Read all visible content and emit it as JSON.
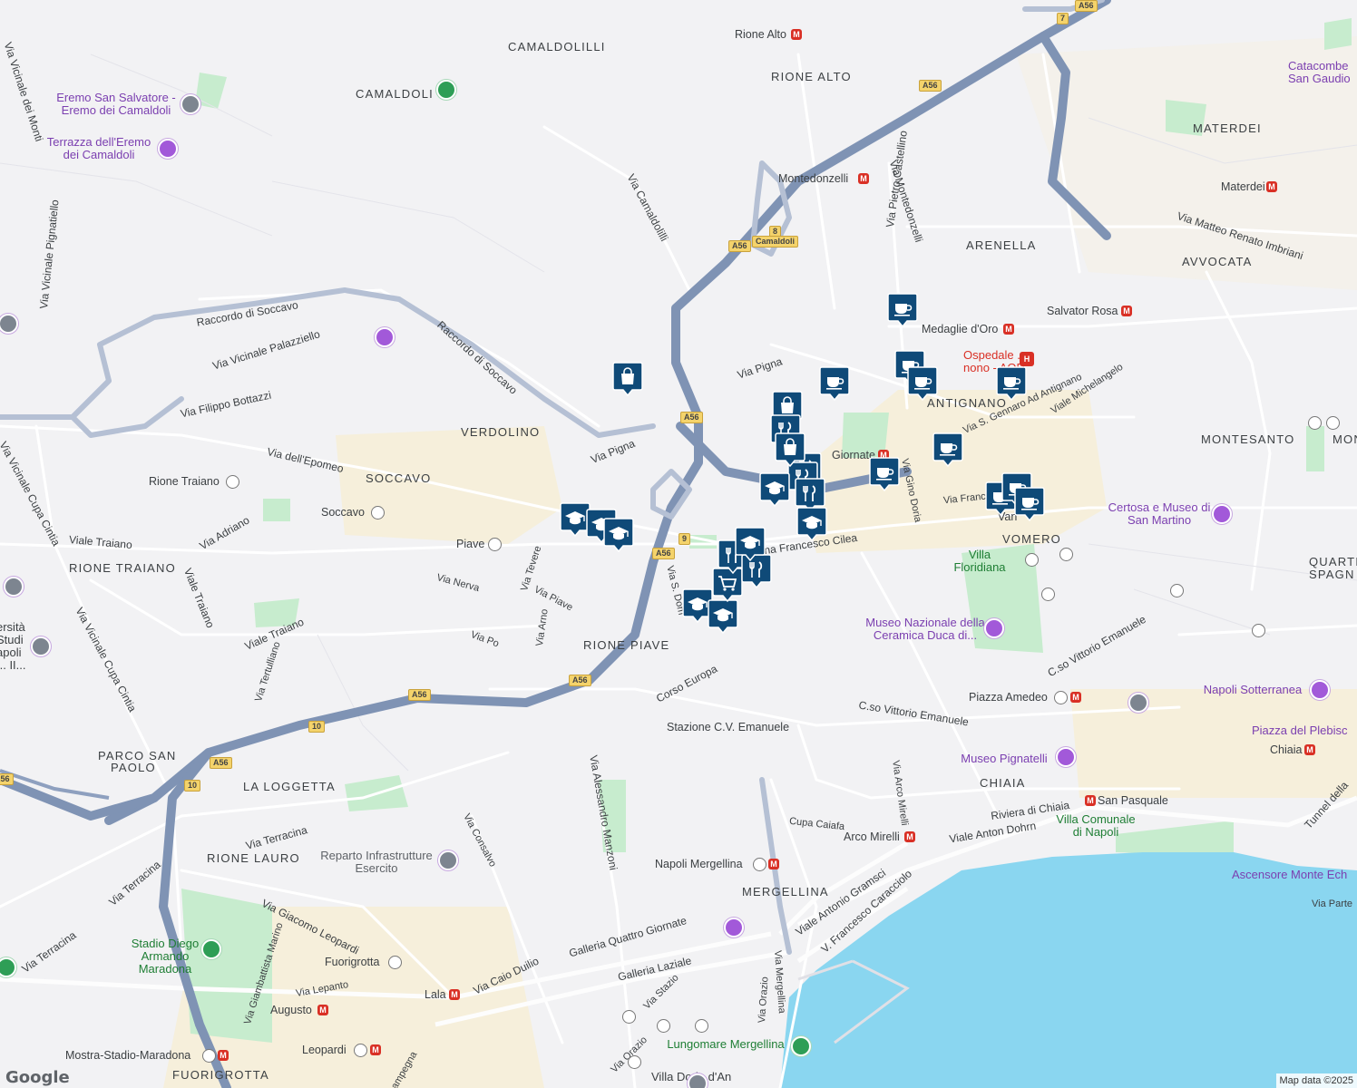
{
  "map": {
    "attribution": "Map data ©2025",
    "logo": "Google",
    "colors": {
      "background": "#f2f2f4",
      "water": "#8ad6f0",
      "park": "#c7ecce",
      "highway": "#7f93b4",
      "road": "#ffffff",
      "urban": "#f6efd8",
      "marker": "#0f4a78"
    }
  },
  "areas": [
    {
      "id": "camaldolilli",
      "text": "CAMALDOLILLI"
    },
    {
      "id": "camaldoli",
      "text": "CAMALDOLI"
    },
    {
      "id": "rione-alto",
      "text": "RIONE ALTO"
    },
    {
      "id": "materdei",
      "text": "MATERDEI"
    },
    {
      "id": "arenella",
      "text": "ARENELLA"
    },
    {
      "id": "avvocata",
      "text": "AVVOCATA"
    },
    {
      "id": "verdolino",
      "text": "VERDOLINO"
    },
    {
      "id": "soccavo",
      "text": "SOCCAVO"
    },
    {
      "id": "antignano",
      "text": "ANTIGNANO"
    },
    {
      "id": "montesanto",
      "text": "MONTESANTO"
    },
    {
      "id": "monte",
      "text": "MONTE"
    },
    {
      "id": "rione-traiano",
      "text": "RIONE TRAIANO"
    },
    {
      "id": "vomero",
      "text": "VOMERO"
    },
    {
      "id": "quartieri",
      "text": "QUARTI"
    },
    {
      "id": "spagnoli",
      "text": "SPAGN"
    },
    {
      "id": "rione-piave",
      "text": "RIONE PIAVE"
    },
    {
      "id": "parco-san-paolo",
      "text": "PARCO SAN"
    },
    {
      "id": "paolo",
      "text": "PAOLO"
    },
    {
      "id": "la-loggetta",
      "text": "LA LOGGETTA"
    },
    {
      "id": "chiaia",
      "text": "CHIAIA"
    },
    {
      "id": "rione-lauro",
      "text": "RIONE LAURO"
    },
    {
      "id": "mergellina",
      "text": "MERGELLINA"
    },
    {
      "id": "fuorigrotta",
      "text": "FUORIGROTTA"
    }
  ],
  "roads": [
    {
      "id": "via-vicinale-dei-monti",
      "text": "Via Vicinale dei Monti"
    },
    {
      "id": "via-vicinale-pignatiello",
      "text": "Via Vicinale Pignatiello"
    },
    {
      "id": "raccordo-soccavo-1",
      "text": "Raccordo di Soccavo"
    },
    {
      "id": "raccordo-soccavo-2",
      "text": "Raccordo di Soccavo"
    },
    {
      "id": "via-vicinale-palazziello",
      "text": "Via Vicinale Palazziello"
    },
    {
      "id": "via-filippo-bottazzi",
      "text": "Via Filippo Bottazzi"
    },
    {
      "id": "via-camaldolilli",
      "text": "Via Camaldolilli"
    },
    {
      "id": "via-pietro-castellino",
      "text": "Via Pietro Castellino"
    },
    {
      "id": "via-montedonzelli",
      "text": "Via Montedonzelli"
    },
    {
      "id": "via-matteo-renato-imbriani",
      "text": "Via Matteo Renato Imbriani"
    },
    {
      "id": "via-pigna-1",
      "text": "Via Pigna"
    },
    {
      "id": "via-pigna-2",
      "text": "Via Pigna"
    },
    {
      "id": "via-dell-epomeo",
      "text": "Via dell'Epomeo"
    },
    {
      "id": "via-s-gennaro",
      "text": "Via S. Gennaro Ad Antignano"
    },
    {
      "id": "viale-michelangelo",
      "text": "Viale Michelangelo"
    },
    {
      "id": "via-vicinale-cupa-cintia-1",
      "text": "Via Vicinale Cupa Cintia"
    },
    {
      "id": "via-vicinale-cupa-cintia-2",
      "text": "Via Vicinale Cupa Cintia"
    },
    {
      "id": "viale-traiano-1",
      "text": "Viale Traiano"
    },
    {
      "id": "via-adriano",
      "text": "Via Adriano"
    },
    {
      "id": "viale-traiano-2",
      "text": "Viale Traiano"
    },
    {
      "id": "viale-traiano-3",
      "text": "Viale Traiano"
    },
    {
      "id": "via-nerva",
      "text": "Via Nerva"
    },
    {
      "id": "via-tevere",
      "text": "Via Tevere"
    },
    {
      "id": "via-piave",
      "text": "Via Piave"
    },
    {
      "id": "via-francesco-cilea",
      "text": "na Francesco Cilea"
    },
    {
      "id": "via-gino-doria",
      "text": "Via Gino Doria"
    },
    {
      "id": "via-franc",
      "text": "Via Franc"
    },
    {
      "id": "via-s-dom",
      "text": "Via S. Dom"
    },
    {
      "id": "via-arno",
      "text": "Via Arno"
    },
    {
      "id": "via-po",
      "text": "Via Po"
    },
    {
      "id": "via-tertulliano",
      "text": "Via Tertulliano"
    },
    {
      "id": "corso-europa",
      "text": "Corso Europa"
    },
    {
      "id": "cso-vittorio-emanuele-1",
      "text": "C.so Vittorio Emanuele"
    },
    {
      "id": "cso-vittorio-emanuele-2",
      "text": "C.so Vittorio Emanuele"
    },
    {
      "id": "via-alessandro-manzoni",
      "text": "Via Alessandro Manzoni"
    },
    {
      "id": "via-arco-mirelli",
      "text": "Via Arco Mirelli"
    },
    {
      "id": "via-consalvo",
      "text": "Via Consalvo"
    },
    {
      "id": "via-terracina-1",
      "text": "Via Terracina"
    },
    {
      "id": "via-terracina-2",
      "text": "Via Terracina"
    },
    {
      "id": "via-terracina-3",
      "text": "Via Terracina"
    },
    {
      "id": "riviera-di-chiaia",
      "text": "Riviera di Chiaia"
    },
    {
      "id": "viale-anton-dohrn",
      "text": "Viale Anton Dohrn"
    },
    {
      "id": "cupa-caiafa",
      "text": "Cupa Caiafa"
    },
    {
      "id": "via-giacomo-leopardi",
      "text": "Via Giacomo Leopardi"
    },
    {
      "id": "galleria-quattro-giornate",
      "text": "Galleria Quattro Giornate"
    },
    {
      "id": "viale-antonio-gramsci",
      "text": "Viale Antonio Gramsci"
    },
    {
      "id": "v-francesco-caracciolo",
      "text": "V. Francesco Caracciolo"
    },
    {
      "id": "via-giambattista-marino",
      "text": "Via Giambattista Marino"
    },
    {
      "id": "via-caio-duilio",
      "text": "Via Caio Duilio"
    },
    {
      "id": "galleria-laziale",
      "text": "Galleria Laziale"
    },
    {
      "id": "via-lepanto",
      "text": "Via Lepanto"
    },
    {
      "id": "via-mergellina",
      "text": "Via Mergellina"
    },
    {
      "id": "via-orazio-1",
      "text": "Via Orazio"
    },
    {
      "id": "via-orazio-2",
      "text": "Via Orazio"
    },
    {
      "id": "via-stazio",
      "text": "Via Stazio"
    },
    {
      "id": "tunnel-della",
      "text": "Tunnel della"
    },
    {
      "id": "via-parte",
      "text": "Via Parte"
    },
    {
      "id": "campegna",
      "text": "ampegna"
    }
  ],
  "places": [
    {
      "id": "eremo-san-salvatore",
      "text": "Eremo San Salvatore - Eremo dei Camaldoli",
      "kind": "poi"
    },
    {
      "id": "terrazza-eremo",
      "text": "Terrazza dell'Eremo dei Camaldoli",
      "kind": "poi"
    },
    {
      "id": "catacombe",
      "text": "Catacombe San Gaudio",
      "kind": "poi"
    },
    {
      "id": "ospedale",
      "text": "Ospedale ... nono - AOR",
      "kind": "hospital"
    },
    {
      "id": "certosa",
      "text": "Certosa e Museo di San Martino",
      "kind": "poi"
    },
    {
      "id": "villa-floridiana",
      "text": "Villa Floridiana",
      "kind": "park"
    },
    {
      "id": "museo-ceramica",
      "text": "Museo Nazionale della Ceramica Duca di...",
      "kind": "poi"
    },
    {
      "id": "napoli-sotterranea",
      "text": "Napoli Sotterranea",
      "kind": "poi"
    },
    {
      "id": "piazza-plebiscito",
      "text": "Piazza del Plebisc",
      "kind": "poi"
    },
    {
      "id": "museo-pignatelli",
      "text": "Museo Pignatelli",
      "kind": "poi"
    },
    {
      "id": "reparto-esercito",
      "text": "Reparto Infrastrutture Esercito",
      "kind": "gov"
    },
    {
      "id": "villa-comunale",
      "text": "Villa Comunale di Napoli",
      "kind": "park"
    },
    {
      "id": "ascensore",
      "text": "Ascensore Monte Ech",
      "kind": "poi"
    },
    {
      "id": "stadio",
      "text": "Stadio Diego Armando Maradona",
      "kind": "park"
    },
    {
      "id": "lungomare",
      "text": "Lungomare Mergellina",
      "kind": "park"
    },
    {
      "id": "villa-doria",
      "text": "Villa Doria d'An",
      "kind": "place"
    },
    {
      "id": "universita",
      "text": "ersità Studi apoli ... II...",
      "kind": "place"
    }
  ],
  "stations": [
    {
      "id": "rione-alto-metro",
      "text": "Rione Alto",
      "type": "metro"
    },
    {
      "id": "montedonzelli",
      "text": "Montedonzelli",
      "type": "metro"
    },
    {
      "id": "materdei-metro",
      "text": "Materdei",
      "type": "metro"
    },
    {
      "id": "medaglie-d-oro",
      "text": "Medaglie d'Oro",
      "type": "metro"
    },
    {
      "id": "salvator-rosa",
      "text": "Salvator Rosa",
      "type": "metro"
    },
    {
      "id": "quattro-giornate",
      "text": "Giornate",
      "type": "metro"
    },
    {
      "id": "rione-traiano-st",
      "text": "Rione Traiano",
      "type": "bus"
    },
    {
      "id": "soccavo-st",
      "text": "Soccavo",
      "type": "bus"
    },
    {
      "id": "piave-st",
      "text": "Piave",
      "type": "bus"
    },
    {
      "id": "vanvitelli",
      "text": "Van",
      "type": "metro"
    },
    {
      "id": "piazza-amedeo",
      "text": "Piazza Amedeo",
      "type": "metro"
    },
    {
      "id": "chiaia-st",
      "text": "Chiaia",
      "type": "metro"
    },
    {
      "id": "stazione-cv",
      "text": "Stazione C.V. Emanuele",
      "type": "bus"
    },
    {
      "id": "san-pasquale",
      "text": "San Pasquale",
      "type": "metro"
    },
    {
      "id": "arco-mirelli",
      "text": "Arco Mirelli",
      "type": "metro"
    },
    {
      "id": "napoli-mergellina",
      "text": "Napoli Mergellina",
      "type": "train"
    },
    {
      "id": "fuorigrotta-st",
      "text": "Fuorigrotta",
      "type": "bus"
    },
    {
      "id": "augusto",
      "text": "Augusto",
      "type": "metro"
    },
    {
      "id": "lala",
      "text": "Lala",
      "type": "metro"
    },
    {
      "id": "leopardi",
      "text": "Leopardi",
      "type": "metro"
    },
    {
      "id": "mostra-stadio",
      "text": "Mostra-Stadio-Maradona",
      "type": "metro"
    },
    {
      "id": "fuorigrotta-area",
      "text": "FUORIGROTTA",
      "type": "area"
    }
  ],
  "shields": [
    {
      "id": "a56-1",
      "text": "A56"
    },
    {
      "id": "a56-2",
      "text": "A56"
    },
    {
      "id": "a56-3",
      "text": "A56"
    },
    {
      "id": "a56-4",
      "text": "A56"
    },
    {
      "id": "a56-5",
      "text": "A56"
    },
    {
      "id": "a56-6",
      "text": "A56"
    },
    {
      "id": "a56-7",
      "text": "A56"
    },
    {
      "id": "a56-8",
      "text": "A56"
    },
    {
      "id": "a56-9",
      "text": "A56"
    },
    {
      "id": "t7",
      "text": "7"
    },
    {
      "id": "t8",
      "text": "8"
    },
    {
      "id": "camaldoli-exit",
      "text": "Camaldoli"
    },
    {
      "id": "t10-1",
      "text": "10"
    },
    {
      "id": "t10-2",
      "text": "10"
    },
    {
      "id": "t9",
      "text": "9"
    }
  ],
  "markers": [
    {
      "id": "m1",
      "icon": "coffee"
    },
    {
      "id": "m2",
      "icon": "coffee"
    },
    {
      "id": "m3",
      "icon": "coffee"
    },
    {
      "id": "m4",
      "icon": "coffee"
    },
    {
      "id": "m5",
      "icon": "coffee"
    },
    {
      "id": "m6",
      "icon": "coffee"
    },
    {
      "id": "m7",
      "icon": "coffee"
    },
    {
      "id": "m8",
      "icon": "coffee"
    },
    {
      "id": "m9",
      "icon": "coffee"
    },
    {
      "id": "m10",
      "icon": "coffee"
    },
    {
      "id": "m11",
      "icon": "shopping-bag"
    },
    {
      "id": "m12",
      "icon": "shopping-bag"
    },
    {
      "id": "m13",
      "icon": "restaurant"
    },
    {
      "id": "m14",
      "icon": "restaurant"
    },
    {
      "id": "m15",
      "icon": "restaurant"
    },
    {
      "id": "m16",
      "icon": "restaurant"
    },
    {
      "id": "m17",
      "icon": "school"
    },
    {
      "id": "m18",
      "icon": "school"
    },
    {
      "id": "m19",
      "icon": "school"
    },
    {
      "id": "m20",
      "icon": "school"
    },
    {
      "id": "m21",
      "icon": "school"
    },
    {
      "id": "m22",
      "icon": "school"
    },
    {
      "id": "m23",
      "icon": "school"
    },
    {
      "id": "m24",
      "icon": "shopping-cart"
    },
    {
      "id": "m25",
      "icon": "restaurant"
    },
    {
      "id": "m26",
      "icon": "shopping-bag"
    },
    {
      "id": "m27",
      "icon": "restaurant"
    },
    {
      "id": "m28",
      "icon": "school"
    }
  ]
}
